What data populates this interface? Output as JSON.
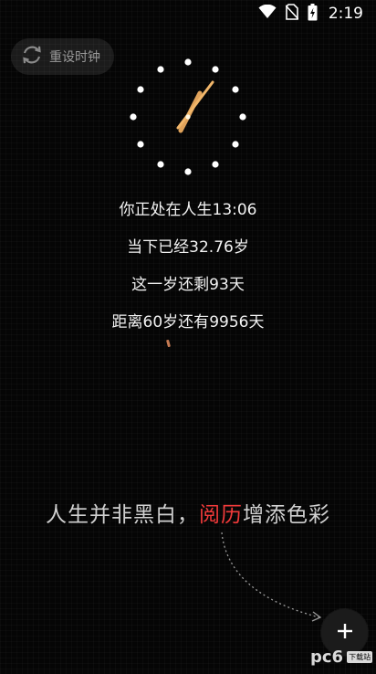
{
  "status_bar": {
    "time": "2:19",
    "icons": [
      "wifi-icon",
      "no-sim-icon",
      "battery-charging-icon"
    ]
  },
  "reset_button": {
    "icon": "refresh-icon",
    "label": "重设时钟"
  },
  "clock": {
    "hour_dots": 12,
    "hand_color": "#e3a15a"
  },
  "stats": {
    "life_time": {
      "prefix": "你正处在人生",
      "value": "13:06"
    },
    "age": {
      "prefix": "当下已经",
      "value": "32.76",
      "suffix": "岁"
    },
    "year_remaining": {
      "prefix": "这一岁还剩",
      "value": "93",
      "suffix": "天"
    },
    "until_60": {
      "prefix": "距离60岁还有",
      "value": "9956",
      "suffix": "天"
    }
  },
  "slogan": {
    "part1": "人生并非黑白，",
    "highlight": "阅历",
    "part2": "增添色彩",
    "highlight_color": "#f03a3a"
  },
  "fab": {
    "icon": "plus-icon"
  },
  "watermark": {
    "text": "pc6",
    "badge": "下载站"
  }
}
